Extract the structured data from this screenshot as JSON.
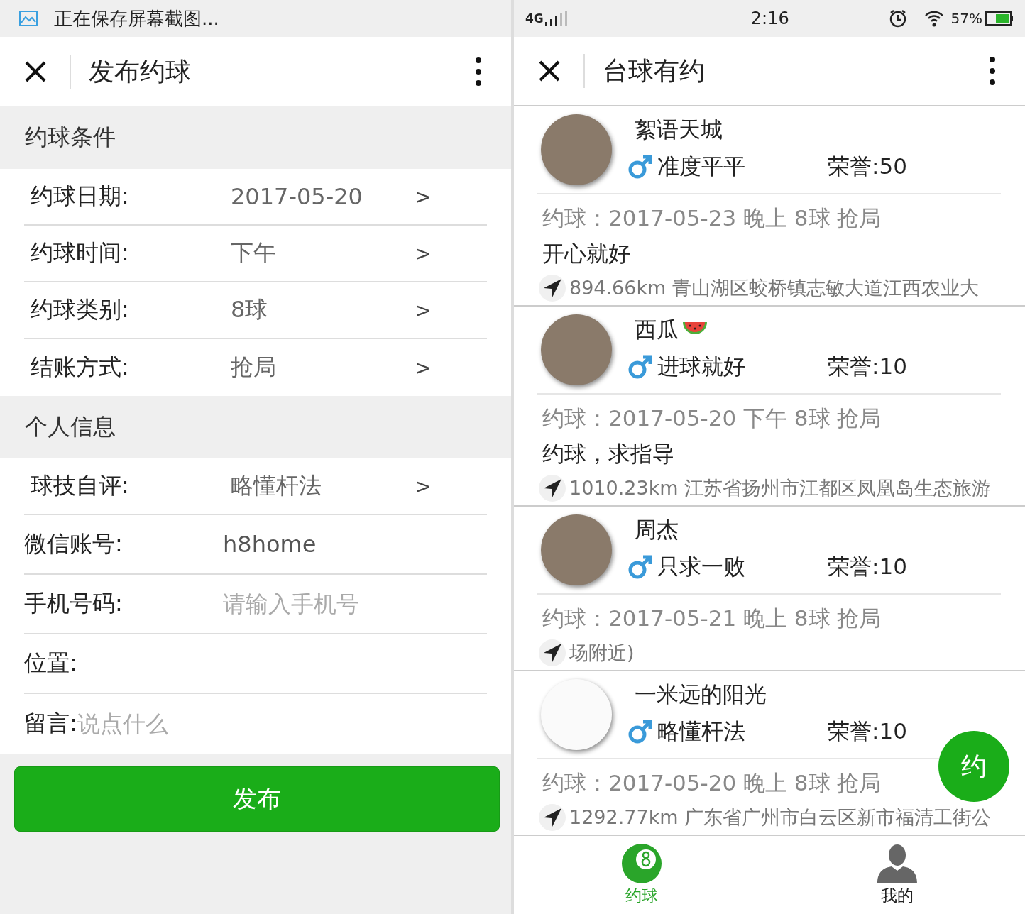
{
  "left_status_bar": {
    "notice": "正在保存屏幕截图..."
  },
  "left_header": {
    "title": "发布约球"
  },
  "sections": [
    {
      "title": "约球条件",
      "rows": [
        {
          "kind": "select",
          "label": "约球日期:",
          "value": "2017-05-20",
          "chevron": ">"
        },
        {
          "kind": "select",
          "label": "约球时间:",
          "value": "下午",
          "chevron": ">"
        },
        {
          "kind": "select",
          "label": "约球类别:",
          "value": "8球",
          "chevron": ">"
        },
        {
          "kind": "select",
          "label": "结账方式:",
          "value": "抢局",
          "chevron": ">"
        }
      ]
    },
    {
      "title": "个人信息",
      "rows": [
        {
          "kind": "select",
          "label": "球技自评:",
          "value": "略懂杆法",
          "chevron": ">"
        },
        {
          "kind": "input",
          "label": "微信账号:",
          "value": "h8home"
        },
        {
          "kind": "input",
          "label": "手机号码:",
          "placeholder": "请输入手机号"
        },
        {
          "kind": "label",
          "label": "位置:"
        },
        {
          "kind": "inline_input",
          "label": "留言:",
          "placeholder": "说点什么"
        }
      ]
    }
  ],
  "submit_button": "发布",
  "right_status_bar": {
    "network": "4G",
    "time": "2:16",
    "battery": "57%"
  },
  "right_header": {
    "title": "台球有约"
  },
  "posts": [
    {
      "name": "絮语天城",
      "kind": "male",
      "skill": "准度平平",
      "honor": "荣誉:50",
      "meta": "约球：2017-05-23 晚上 8球 抢局",
      "message": "开心就好",
      "location": "894.66km 青山湖区蛟桥镇志敏大道江西农业大"
    },
    {
      "name": "西瓜",
      "name_icon": {
        "kind": "watermelon"
      },
      "kind": "male",
      "skill": "进球就好",
      "honor": "荣誉:10",
      "meta": "约球：2017-05-20 下午 8球 抢局",
      "message": "约球，求指导",
      "location": "1010.23km 江苏省扬州市江都区凤凰岛生态旅游"
    },
    {
      "name": "周杰",
      "kind": "male",
      "skill": "只求一败",
      "honor": "荣誉:10",
      "meta": "约球：2017-05-21 晚上 8球 抢局",
      "location": "场附近)"
    },
    {
      "name": "一米远的阳光",
      "kind": "male",
      "skill": "略懂杆法",
      "honor": "荣誉:10",
      "meta": "约球：2017-05-20 晚上 8球 抢局",
      "location": "1292.77km 广东省广州市白云区新市福清工街公"
    }
  ],
  "fab": "约",
  "tabs": [
    {
      "label": "约球",
      "selected": true
    },
    {
      "label": "我的",
      "selected": false
    }
  ]
}
